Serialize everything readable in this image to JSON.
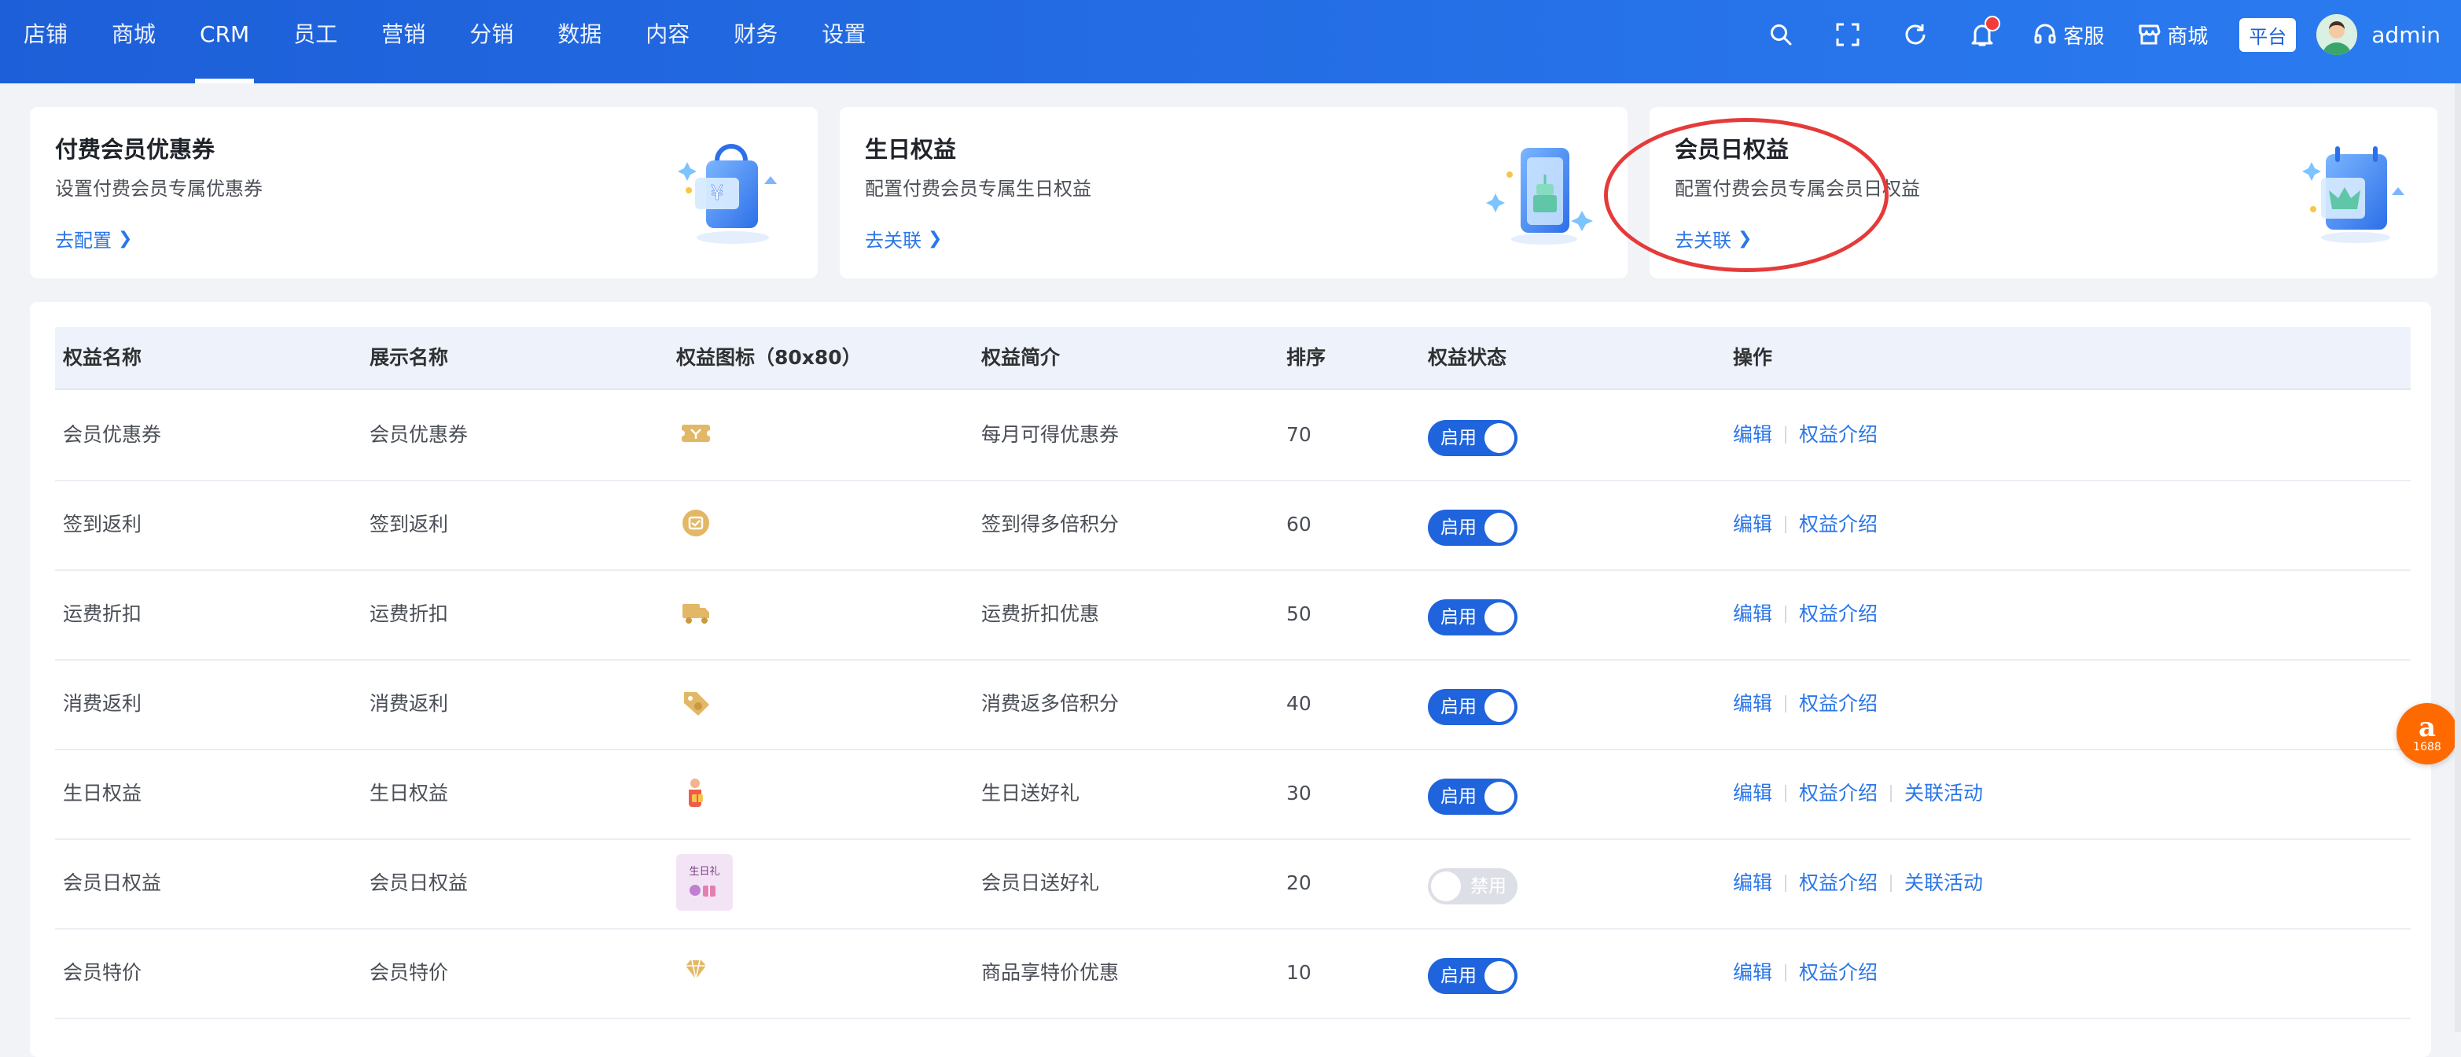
{
  "nav": {
    "items": [
      "店铺",
      "商城",
      "CRM",
      "员工",
      "营销",
      "分销",
      "数据",
      "内容",
      "财务",
      "设置"
    ],
    "active": "CRM"
  },
  "toolbar": {
    "service_label": "客服",
    "mall_label": "商城",
    "platform_label": "平台",
    "user_name": "admin",
    "notification_dot_color": "#f23c3c"
  },
  "cards": [
    {
      "title": "付费会员优惠券",
      "desc": "设置付费会员专属优惠券",
      "link": "去配置",
      "icon": "coupon-bag-icon"
    },
    {
      "title": "生日权益",
      "desc": "配置付费会员专属生日权益",
      "link": "去关联",
      "icon": "birthday-cake-phone-icon"
    },
    {
      "title": "会员日权益",
      "desc": "配置付费会员专属会员日权益",
      "link": "去关联",
      "icon": "calendar-crown-icon"
    }
  ],
  "table": {
    "headers": [
      "权益名称",
      "展示名称",
      "权益图标（80x80）",
      "权益简介",
      "排序",
      "权益状态",
      "操作"
    ],
    "rows": [
      {
        "name": "会员优惠券",
        "display": "会员优惠券",
        "icon": "ticket-icon",
        "intro": "每月可得优惠券",
        "order": "70",
        "status": "启用",
        "enabled": true,
        "ops": [
          "编辑",
          "权益介绍"
        ]
      },
      {
        "name": "签到返利",
        "display": "签到返利",
        "icon": "checkin-coin-icon",
        "intro": "签到得多倍积分",
        "order": "60",
        "status": "启用",
        "enabled": true,
        "ops": [
          "编辑",
          "权益介绍"
        ]
      },
      {
        "name": "运费折扣",
        "display": "运费折扣",
        "icon": "truck-icon",
        "intro": "运费折扣优惠",
        "order": "50",
        "status": "启用",
        "enabled": true,
        "ops": [
          "编辑",
          "权益介绍"
        ]
      },
      {
        "name": "消费返利",
        "display": "消费返利",
        "icon": "tag-coin-icon",
        "intro": "消费返多倍积分",
        "order": "40",
        "status": "启用",
        "enabled": true,
        "ops": [
          "编辑",
          "权益介绍"
        ]
      },
      {
        "name": "生日权益",
        "display": "生日权益",
        "icon": "gift-figure-icon",
        "intro": "生日送好礼",
        "order": "30",
        "status": "启用",
        "enabled": true,
        "ops": [
          "编辑",
          "权益介绍",
          "关联活动"
        ]
      },
      {
        "name": "会员日权益",
        "display": "会员日权益",
        "icon": "birthday-gift-thumbnail",
        "icon_text": "生日礼",
        "intro": "会员日送好礼",
        "order": "20",
        "status": "禁用",
        "enabled": false,
        "ops": [
          "编辑",
          "权益介绍",
          "关联活动"
        ]
      },
      {
        "name": "会员特价",
        "display": "会员特价",
        "icon": "diamond-icon",
        "intro": "商品享特价优惠",
        "order": "10",
        "status": "启用",
        "enabled": true,
        "ops": [
          "编辑",
          "权益介绍"
        ]
      }
    ]
  },
  "float_badge": {
    "big": "a",
    "small": "1688"
  },
  "colors": {
    "primary": "#2b76e8",
    "nav_bg": "#1d5fd8",
    "switch_on": "#1f64dc",
    "switch_off": "#dcdfe6",
    "annotation": "#e63a3a"
  }
}
